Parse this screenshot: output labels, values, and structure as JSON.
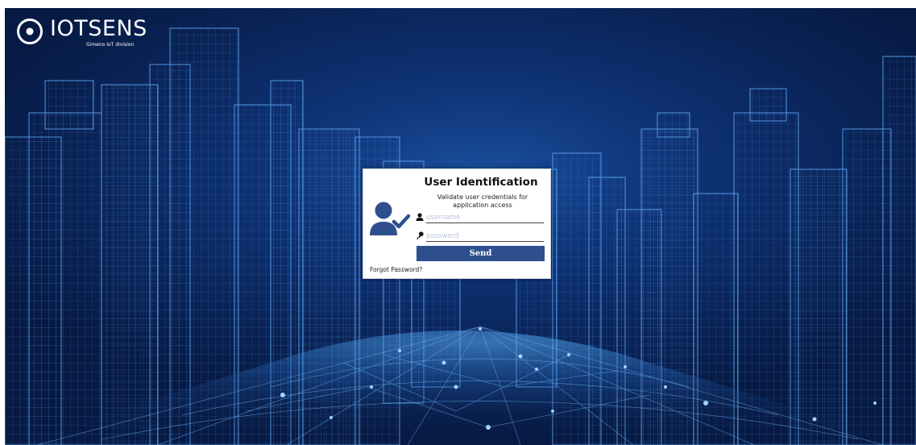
{
  "brand": {
    "name": "IOTSENS",
    "tagline": "Gimeno IoT division",
    "logo_icon": "target-dot-icon"
  },
  "login": {
    "title": "User Identification",
    "subtitle": "Validate user credentials for application access",
    "username": {
      "placeholder": "username",
      "value": "",
      "icon": "user-icon"
    },
    "password": {
      "placeholder": "password",
      "value": "",
      "icon": "key-icon"
    },
    "send_label": "Send",
    "forgot_label": "Forgot Password?",
    "avatar_icon": "user-check-icon"
  },
  "colors": {
    "background_dark": "#0a2559",
    "background_glow": "#1a4f9c",
    "wireframe": "#4f93e0",
    "button": "#2d4f8e",
    "avatar": "#2d4f8e"
  }
}
